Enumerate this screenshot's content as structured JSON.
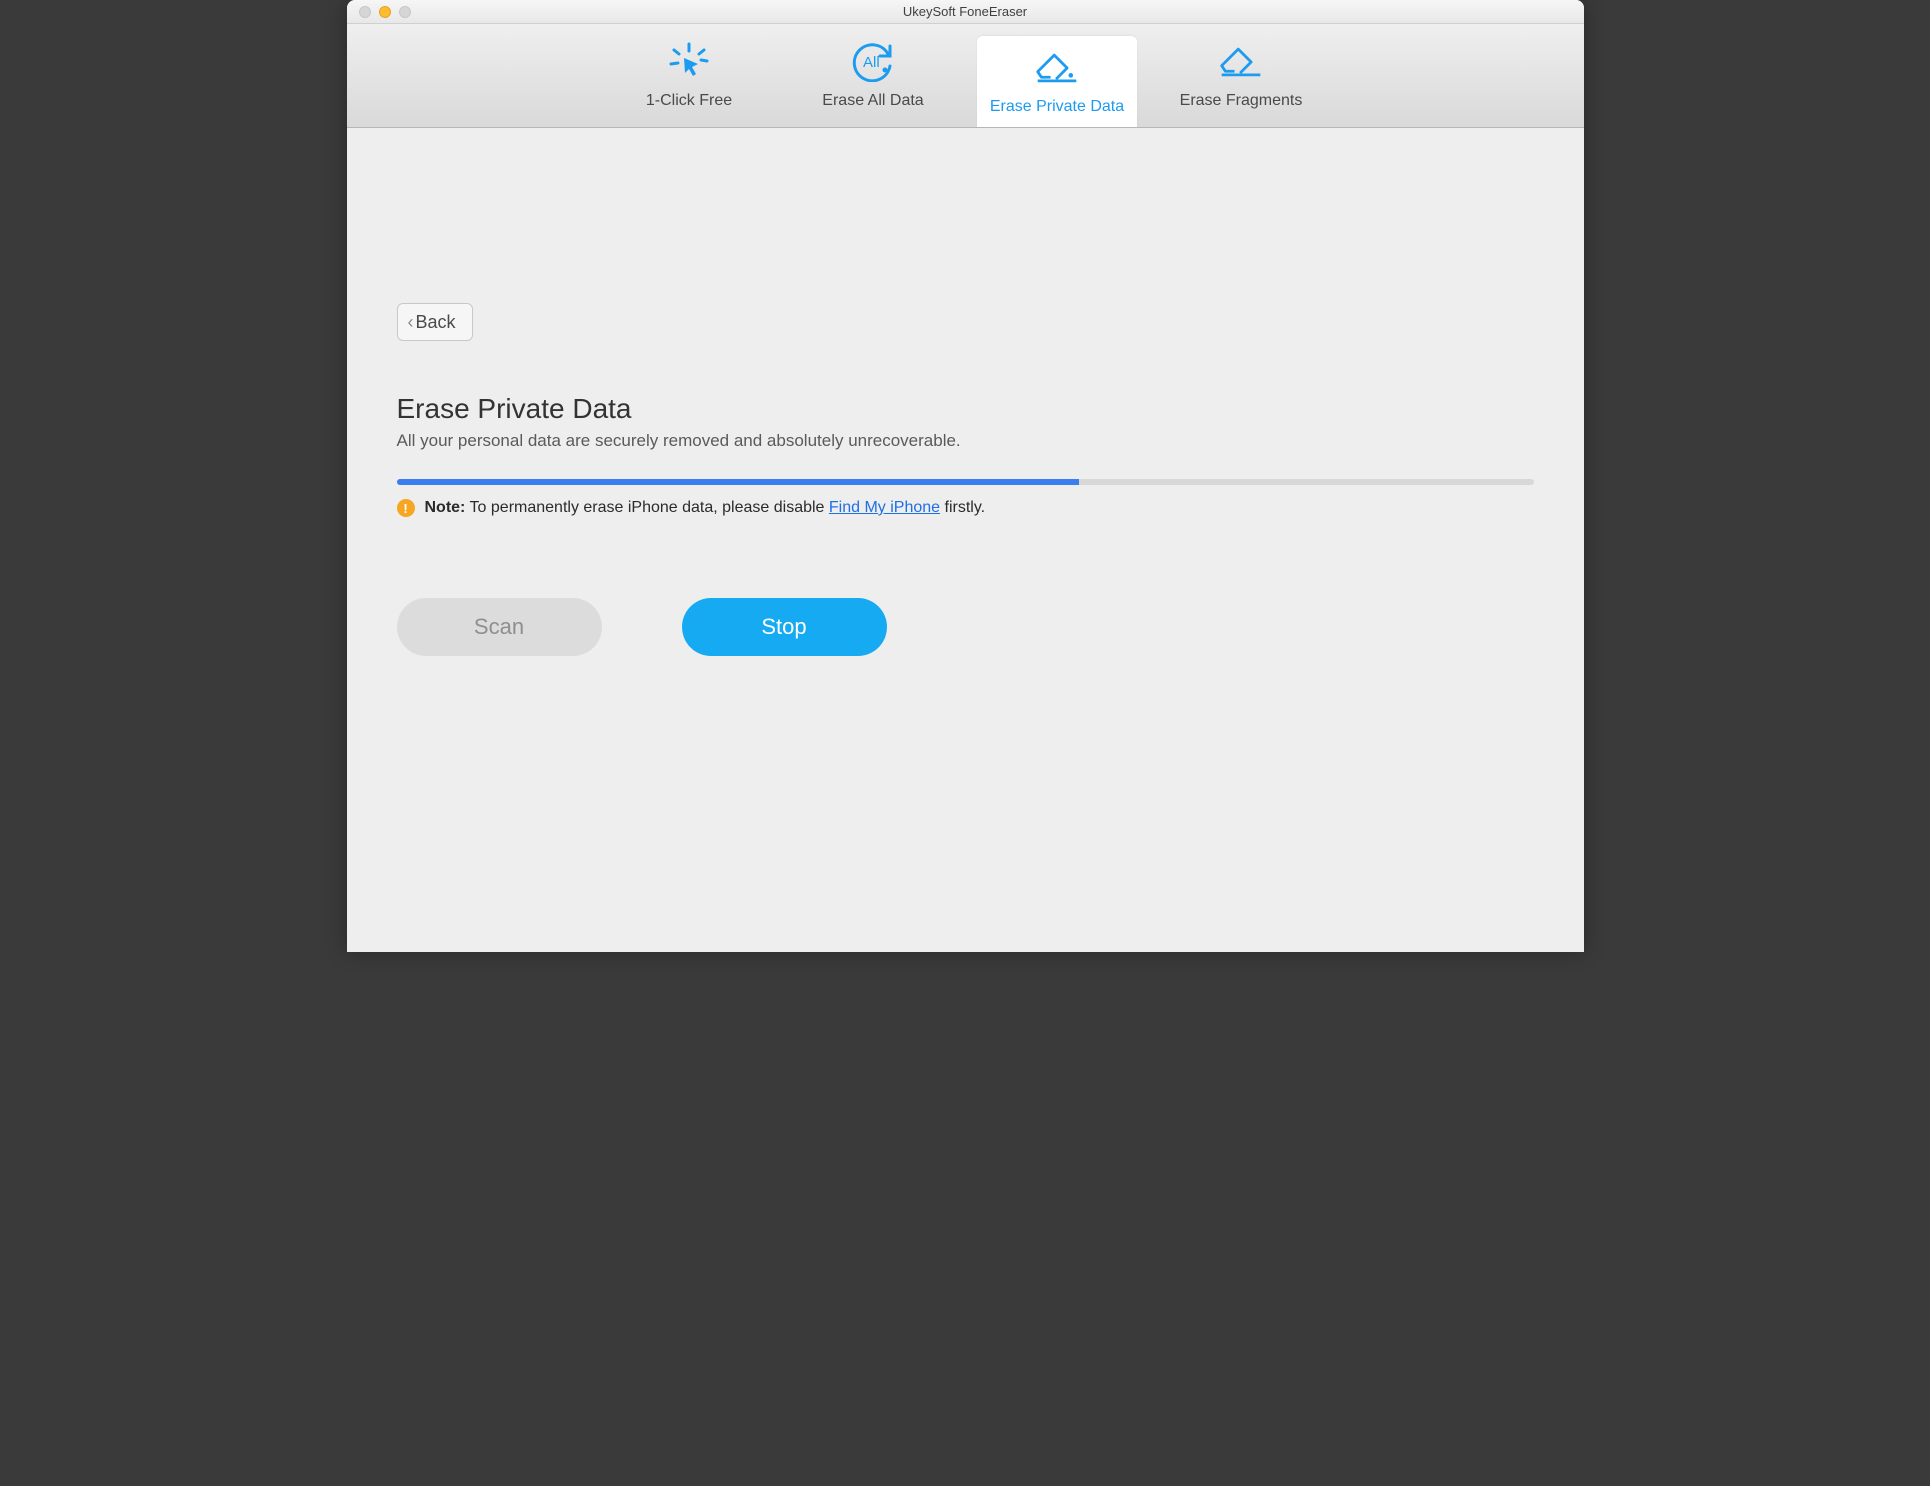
{
  "window": {
    "title": "UkeySoft FoneEraser"
  },
  "tabs": {
    "one_click": "1-Click Free",
    "erase_all": "Erase All Data",
    "erase_private": "Erase Private Data",
    "erase_fragments": "Erase Fragments"
  },
  "back": {
    "label": "Back"
  },
  "section": {
    "heading": "Erase Private Data",
    "description": "All your personal data are securely removed and absolutely unrecoverable."
  },
  "progress": {
    "percent": 60
  },
  "note": {
    "label": "Note:",
    "pre_text": "To permanently erase iPhone data, please disable ",
    "link_text": "Find My iPhone",
    "post_text": " firstly."
  },
  "buttons": {
    "scan": "Scan",
    "stop": "Stop"
  }
}
